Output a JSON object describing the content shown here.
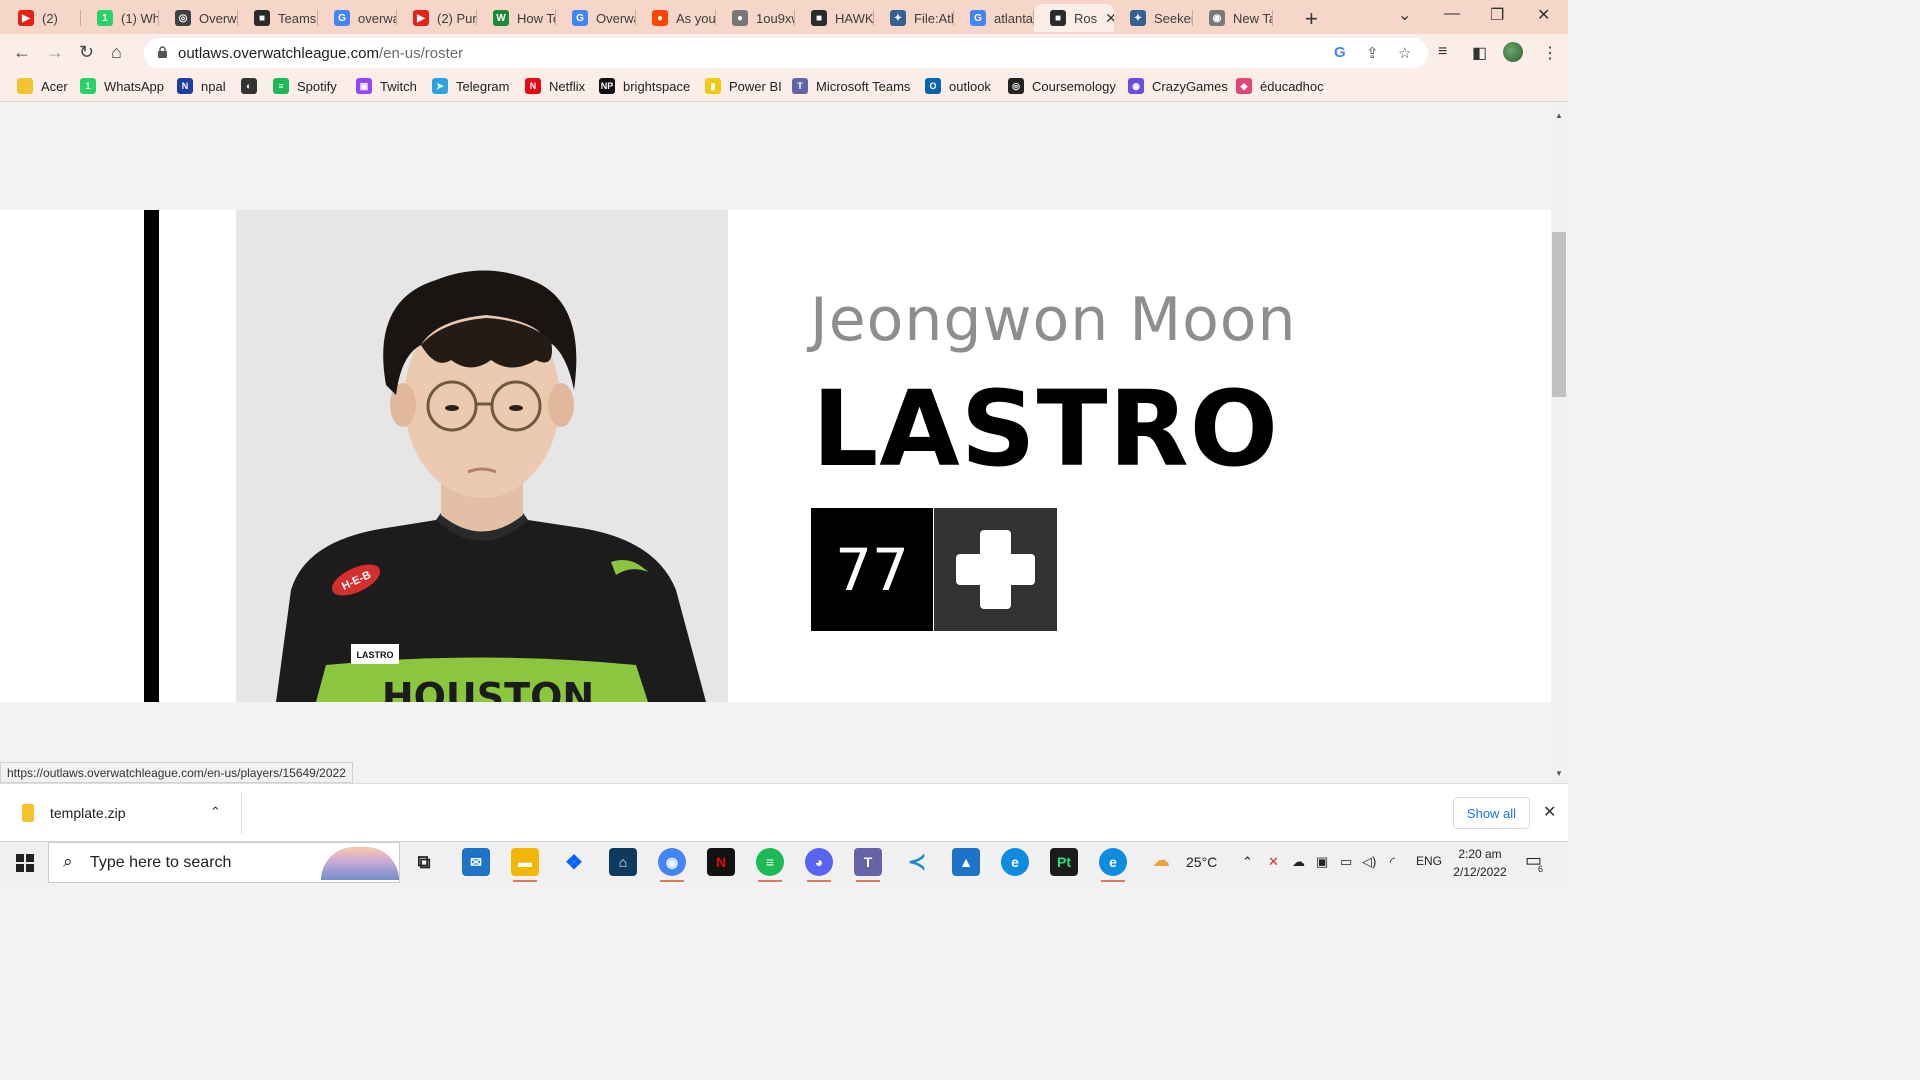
{
  "browser": {
    "tabs": [
      {
        "label": "(2)",
        "color": "#e62117",
        "glyph": "▶"
      },
      {
        "label": "(1) Wha",
        "color": "#25d366",
        "glyph": "1"
      },
      {
        "label": "Overwa",
        "color": "#404040",
        "glyph": "◎"
      },
      {
        "label": "Teams",
        "color": "#2b2b2b",
        "glyph": "■"
      },
      {
        "label": "overwa",
        "color": "#4285f4",
        "glyph": "G"
      },
      {
        "label": "(2) Pure",
        "color": "#e62117",
        "glyph": "▶"
      },
      {
        "label": "How To",
        "color": "#1a8a3a",
        "glyph": "W"
      },
      {
        "label": "Overwa",
        "color": "#4285f4",
        "glyph": "G"
      },
      {
        "label": "As you",
        "color": "#ff4500",
        "glyph": "●"
      },
      {
        "label": "1ou9xw",
        "color": "#777777",
        "glyph": "●"
      },
      {
        "label": "HAWK",
        "color": "#2b2b2b",
        "glyph": "■"
      },
      {
        "label": "File:Atl",
        "color": "#35608f",
        "glyph": "✦"
      },
      {
        "label": "atlanta",
        "color": "#4285f4",
        "glyph": "G"
      },
      {
        "label": "Ros",
        "color": "#2b2b2b",
        "glyph": "■"
      },
      {
        "label": "Seeker",
        "color": "#35608f",
        "glyph": "✦"
      },
      {
        "label": "New Ta",
        "color": "#777777",
        "glyph": "◉"
      }
    ],
    "active_tab_index": 13,
    "url_host": "outlaws.overwatchleague.com",
    "url_path": "/en-us/roster",
    "bookmarks": [
      {
        "label": "Acer",
        "color": "#f4c430",
        "glyph": ""
      },
      {
        "label": "WhatsApp",
        "color": "#25d366",
        "glyph": "1"
      },
      {
        "label": "npal",
        "color": "#1d3f9e",
        "glyph": "N"
      },
      {
        "label": "",
        "color": "#333333",
        "glyph": "◐"
      },
      {
        "label": "Spotify",
        "color": "#1db954",
        "glyph": "≡"
      },
      {
        "label": "Twitch",
        "color": "#9146ff",
        "glyph": "▣"
      },
      {
        "label": "Telegram",
        "color": "#2aa3e0",
        "glyph": "➤"
      },
      {
        "label": "Netflix",
        "color": "#e50914",
        "glyph": "N"
      },
      {
        "label": "brightspace",
        "color": "#111111",
        "glyph": "NP"
      },
      {
        "label": "Power BI",
        "color": "#f2c811",
        "glyph": "▮"
      },
      {
        "label": "Microsoft Teams",
        "color": "#6264a7",
        "glyph": "T"
      },
      {
        "label": "outlook",
        "color": "#0a64b5",
        "glyph": "O"
      },
      {
        "label": "Coursemology",
        "color": "#222222",
        "glyph": "◎"
      },
      {
        "label": "CrazyGames",
        "color": "#6c4ce0",
        "glyph": "◉"
      },
      {
        "label": "éducadhoc",
        "color": "#e0457b",
        "glyph": "◆"
      }
    ]
  },
  "player": {
    "real_name": "Jeongwon Moon",
    "handle": "LASTRO",
    "number": "77",
    "role_icon": "support-plus-icon",
    "jersey_tag": "LASTRO",
    "jersey_text": "HOUSTON",
    "sponsor": "H-E-B"
  },
  "status_url": "https://outlaws.overwatchleague.com/en-us/players/15649/2022",
  "download": {
    "filename": "template.zip",
    "show_all": "Show all"
  },
  "taskbar": {
    "search_placeholder": "Type here to search",
    "weather": "25°C",
    "language": "ENG",
    "time": "2:20 am",
    "date": "2/12/2022",
    "notifications": "6"
  }
}
